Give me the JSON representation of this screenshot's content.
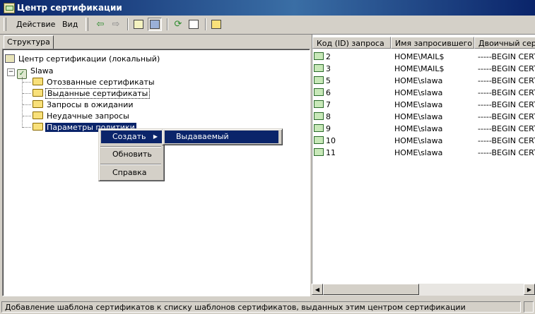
{
  "window": {
    "title": "Центр сертификации"
  },
  "menu": {
    "action": "Действие",
    "view": "Вид"
  },
  "toolbar_icons": [
    "back-arrow-icon",
    "forward-arrow-icon",
    "up-folder-icon",
    "show-hide-tree-icon",
    "refresh-icon",
    "export-list-icon",
    "help-icon"
  ],
  "left_tab": "Структура",
  "tree": {
    "root": "Центр сертификации (локальный)",
    "server": "Slawa",
    "children": [
      "Отозванные сертификаты",
      "Выданные сертификаты",
      "Запросы в ожидании",
      "Неудачные запросы",
      "Параметры политики"
    ]
  },
  "list": {
    "columns": [
      "Код (ID) запроса",
      "Имя запросившего",
      "Двоичный серти"
    ],
    "rows": [
      {
        "id": "2",
        "name": "HOME\\MAIL$",
        "bin": "-----BEGIN CERTI"
      },
      {
        "id": "3",
        "name": "HOME\\MAIL$",
        "bin": "-----BEGIN CERTI"
      },
      {
        "id": "5",
        "name": "HOME\\slawa",
        "bin": "-----BEGIN CERTI"
      },
      {
        "id": "6",
        "name": "HOME\\slawa",
        "bin": "-----BEGIN CERTI"
      },
      {
        "id": "7",
        "name": "HOME\\slawa",
        "bin": "-----BEGIN CERTI"
      },
      {
        "id": "8",
        "name": "HOME\\slawa",
        "bin": "-----BEGIN CERTI"
      },
      {
        "id": "9",
        "name": "HOME\\slawa",
        "bin": "-----BEGIN CERTI"
      },
      {
        "id": "10",
        "name": "HOME\\slawa",
        "bin": "-----BEGIN CERTI"
      },
      {
        "id": "11",
        "name": "HOME\\slawa",
        "bin": "-----BEGIN CERTI"
      }
    ]
  },
  "context_menu": {
    "create": "Создать",
    "refresh": "Обновить",
    "help": "Справка"
  },
  "submenu": {
    "issued_cert": "Выдаваемый сертификат"
  },
  "status": {
    "text": "Добавление шаблона сертификатов к списку шаблонов сертификатов, выданных этим центром сертификации"
  },
  "colors": {
    "selection": "#0a246a",
    "face": "#d4d0c8"
  }
}
